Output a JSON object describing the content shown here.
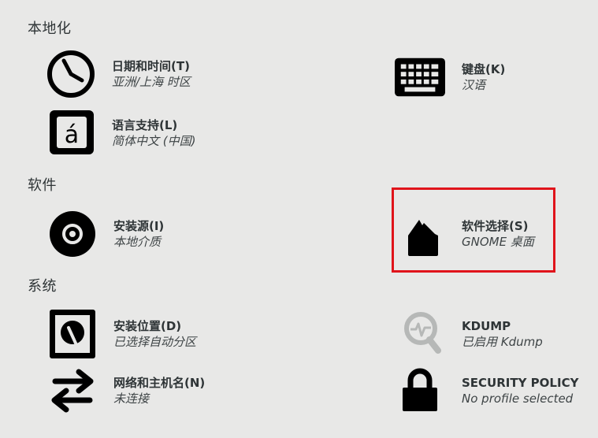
{
  "sections": {
    "localization": "本地化",
    "software": "软件",
    "system": "系统"
  },
  "spokes": {
    "datetime": {
      "title": "日期和时间(T)",
      "status": "亚洲/上海 时区",
      "icon": "clock-icon"
    },
    "keyboard": {
      "title": "键盘(K)",
      "status": "汉语",
      "icon": "keyboard-icon"
    },
    "language": {
      "title": "语言支持(L)",
      "status": "简体中文 (中国)",
      "icon": "language-icon"
    },
    "source": {
      "title": "安装源(I)",
      "status": "本地介质",
      "icon": "disc-icon"
    },
    "software_selection": {
      "title": "软件选择(S)",
      "status": "GNOME 桌面",
      "icon": "package-icon"
    },
    "destination": {
      "title": "安装位置(D)",
      "status": "已选择自动分区",
      "icon": "harddisk-icon"
    },
    "kdump": {
      "title": "KDUMP",
      "status": "已启用 Kdump",
      "icon": "kdump-search-icon"
    },
    "network": {
      "title": "网络和主机名(N)",
      "status": "未连接",
      "icon": "network-arrows-icon"
    },
    "security": {
      "title": "SECURITY POLICY",
      "status": "No profile selected",
      "icon": "lock-icon"
    }
  },
  "colors": {
    "background": "#e8e8e7",
    "highlight": "#e0141b",
    "icon": "#000000",
    "icon_disabled": "#b6b8b7"
  }
}
